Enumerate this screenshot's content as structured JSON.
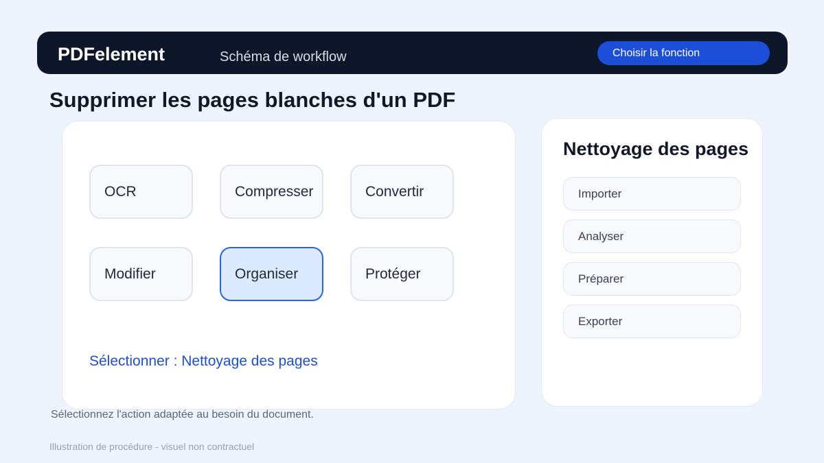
{
  "header": {
    "brand": "PDFelement",
    "subtitle": "Schéma de workflow",
    "choose_button": "Choisir la fonction"
  },
  "page_title": "Supprimer les pages blanches d'un PDF",
  "tools": [
    {
      "label": "OCR",
      "selected": false
    },
    {
      "label": "Compresser",
      "selected": false
    },
    {
      "label": "Convertir",
      "selected": false
    },
    {
      "label": "Modifier",
      "selected": false
    },
    {
      "label": "Organiser",
      "selected": true
    },
    {
      "label": "Protéger",
      "selected": false
    }
  ],
  "selection_text": "Sélectionner : Nettoyage des pages",
  "side_panel": {
    "title": "Nettoyage des pages",
    "steps": [
      "Importer",
      "Analyser",
      "Préparer",
      "Exporter"
    ]
  },
  "hint": "Sélectionnez l'action adaptée au besoin du document.",
  "disclaimer": "Illustration de procédure - visuel non contractuel",
  "colors": {
    "header_bg": "#0e172a",
    "accent": "#1d4ed8",
    "selected_tile_bg": "#dbeafe",
    "page_bg": "#eef4fd"
  }
}
